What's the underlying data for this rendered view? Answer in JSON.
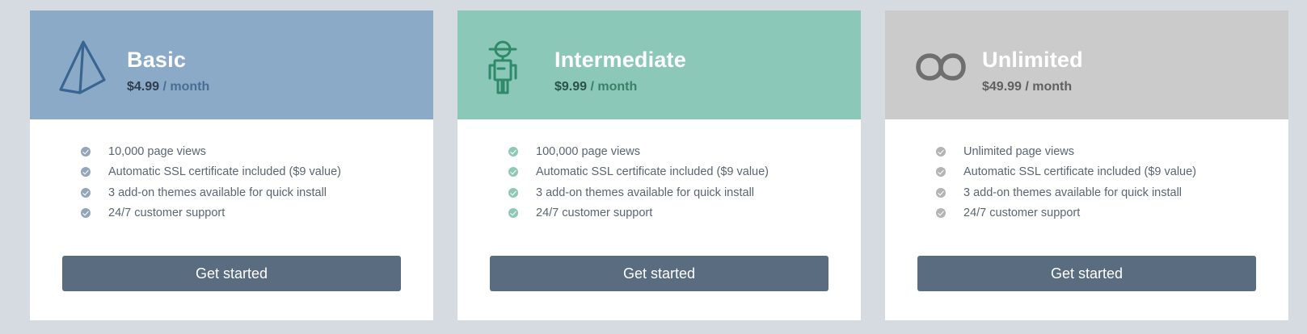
{
  "plans": [
    {
      "name": "Basic",
      "price": "$4.99",
      "period": "/ month",
      "icon": "pyramid-icon",
      "header_color": "#8aaac8",
      "icon_color": "#3b6591",
      "price_color": "#2f3d4e",
      "period_color": "#4a6d93",
      "check_color": "#93a6b9",
      "features": [
        "10,000 page views",
        "Automatic SSL certificate included ($9 value)",
        "3 add-on themes available for quick install",
        "24/7 customer support"
      ],
      "cta_label": "Get started"
    },
    {
      "name": "Intermediate",
      "price": "$9.99",
      "period": "/ month",
      "icon": "robot-icon",
      "header_color": "#8bc8b7",
      "icon_color": "#2f8a69",
      "price_color": "#2a5248",
      "period_color": "#3a7f68",
      "check_color": "#8fc9b6",
      "features": [
        "100,000 page views",
        "Automatic SSL certificate included ($9 value)",
        "3 add-on themes available for quick install",
        "24/7 customer support"
      ],
      "cta_label": "Get started"
    },
    {
      "name": "Unlimited",
      "price": "$49.99",
      "period": "/ month",
      "icon": "infinity-icon",
      "header_color": "#cbcbcb",
      "icon_color": "#6f6f6f",
      "price_color": "#606060",
      "period_color": "#606060",
      "check_color": "#b4b4b4",
      "features": [
        "Unlimited page views",
        "Automatic SSL certificate included ($9 value)",
        "3 add-on themes available for quick install",
        "24/7 customer support"
      ],
      "cta_label": "Get started"
    }
  ]
}
